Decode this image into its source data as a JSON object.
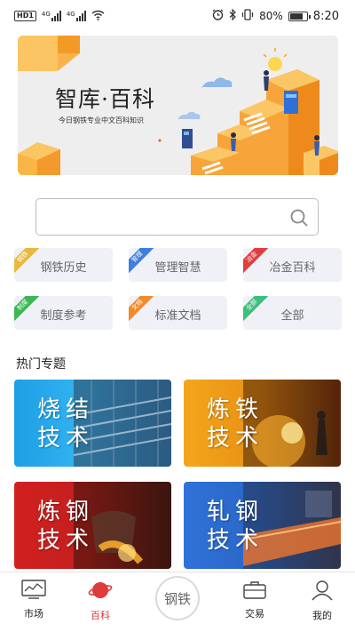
{
  "status_bar": {
    "hd_badge": "HD",
    "sim1": "1",
    "net1": "4G",
    "net2": "4G",
    "battery_percent": "80%",
    "battery_level": 0.8,
    "time": "8:20",
    "icons": [
      "alarm-icon",
      "bluetooth-icon",
      "vibrate-icon",
      "battery-icon",
      "wifi-icon"
    ]
  },
  "banner": {
    "title": "智库·百科",
    "subtitle": "今日钢铁专业中文百科知识"
  },
  "search": {
    "placeholder": "",
    "icon": "search-icon"
  },
  "categories": [
    {
      "label": "钢铁历史",
      "tag": "钢铁",
      "tag_color": "#e8b93a"
    },
    {
      "label": "管理智慧",
      "tag": "管理",
      "tag_color": "#3d7ede"
    },
    {
      "label": "冶金百科",
      "tag": "冶金",
      "tag_color": "#e23d3d"
    },
    {
      "label": "制度参考",
      "tag": "制度",
      "tag_color": "#3db654"
    },
    {
      "label": "标准文档",
      "tag": "文档",
      "tag_color": "#f08a2c"
    },
    {
      "label": "全部",
      "tag": "全部",
      "tag_color": "#3dbf7c"
    }
  ],
  "section": {
    "hot_title": "热门专题"
  },
  "topics": [
    {
      "line1": "烧结",
      "line2": "技术",
      "color": "#27a3e8"
    },
    {
      "line1": "炼铁",
      "line2": "技术",
      "color": "#f0a21e"
    },
    {
      "line1": "炼钢",
      "line2": "技术",
      "color": "#d9262a"
    },
    {
      "line1": "轧钢",
      "line2": "技术",
      "color": "#2d6fd8"
    }
  ],
  "nav": {
    "market": "市场",
    "baike": "百科",
    "center": "钢铁",
    "trade": "交易",
    "mine": "我的",
    "active_color": "#d63a3a"
  }
}
